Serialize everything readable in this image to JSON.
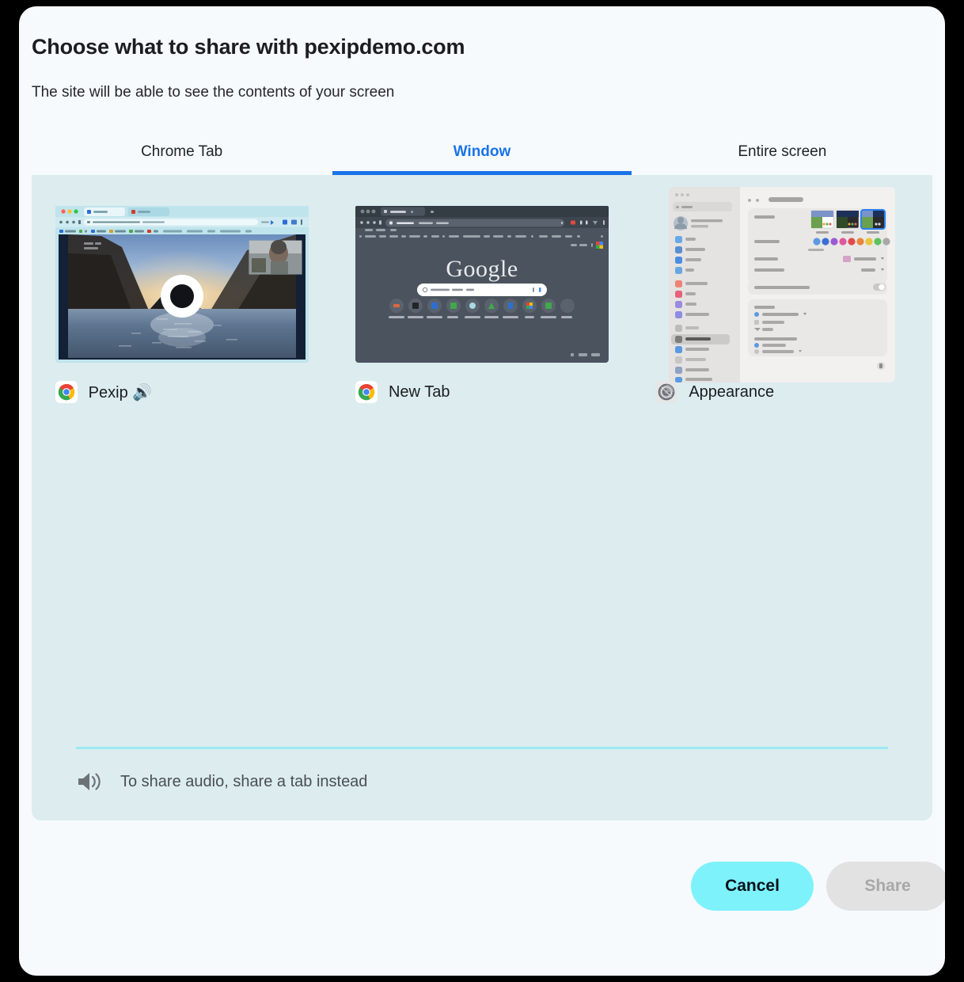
{
  "dialog": {
    "title": "Choose what to share with pexipdemo.com",
    "subtitle": "The site will be able to see the contents of your screen"
  },
  "tabs": [
    {
      "label": "Chrome Tab",
      "active": false,
      "name": "tab-chrome-tab"
    },
    {
      "label": "Window",
      "active": true,
      "name": "tab-window"
    },
    {
      "label": "Entire screen",
      "active": false,
      "name": "tab-entire-screen"
    }
  ],
  "sources": [
    {
      "label": "Pexip 🔊",
      "icon": "chrome-icon",
      "preview": "pexip-video-call-window"
    },
    {
      "label": "New Tab",
      "icon": "chrome-icon",
      "preview": "chrome-new-tab-window"
    },
    {
      "label": "Appearance",
      "icon": "system-settings-icon",
      "preview": "macos-system-settings-appearance-window"
    }
  ],
  "audio_hint": {
    "icon": "speaker-icon",
    "text": "To share audio, share a tab instead"
  },
  "footer": {
    "cancel_label": "Cancel",
    "share_label": "Share",
    "share_disabled": true
  },
  "colors": {
    "dialog_bg": "#f6fafd",
    "panel_bg": "#dcecef",
    "tab_active": "#1a73e8",
    "cancel_bg": "#7ef2fb",
    "share_bg": "#e2e2e2",
    "divider": "#9fe9f2",
    "backdrop": "#000000"
  }
}
